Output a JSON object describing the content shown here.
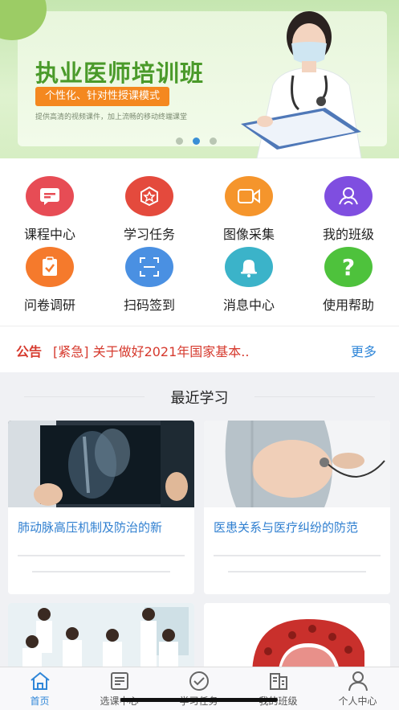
{
  "banner": {
    "title": "执业医师培训班",
    "pill": "个性化、针对性授课模式",
    "subtitle": "提供高清的视频课件，加上流畅的移动终端课堂"
  },
  "grid": [
    {
      "label": "课程中心",
      "icon": "course-icon",
      "color": "#e74c55"
    },
    {
      "label": "学习任务",
      "icon": "task-badge-icon",
      "color": "#e44a3d"
    },
    {
      "label": "图像采集",
      "icon": "video-camera-icon",
      "color": "#f5952c"
    },
    {
      "label": "我的班级",
      "icon": "class-icon",
      "color": "#7f4ee0"
    },
    {
      "label": "问卷调研",
      "icon": "survey-icon",
      "color": "#f57a2c"
    },
    {
      "label": "扫码签到",
      "icon": "scan-icon",
      "color": "#4a90e2"
    },
    {
      "label": "消息中心",
      "icon": "bell-icon",
      "color": "#3bb3c9"
    },
    {
      "label": "使用帮助",
      "icon": "help-icon",
      "color": "#4ec23c"
    }
  ],
  "notice": {
    "tag": "公告",
    "text": "[紧急] 关于做好2021年国家基本..",
    "more": "更多"
  },
  "recent": {
    "title": "最近学习",
    "cards": [
      {
        "title": "肺动脉高压机制及防治的新"
      },
      {
        "title": "医患关系与医疗纠纷的防范"
      }
    ]
  },
  "tabbar": [
    {
      "label": "首页",
      "icon": "home-icon"
    },
    {
      "label": "选课中心",
      "icon": "course-select-icon"
    },
    {
      "label": "学习任务",
      "icon": "check-circle-icon"
    },
    {
      "label": "我的班级",
      "icon": "class-book-icon"
    },
    {
      "label": "个人中心",
      "icon": "user-icon"
    }
  ]
}
